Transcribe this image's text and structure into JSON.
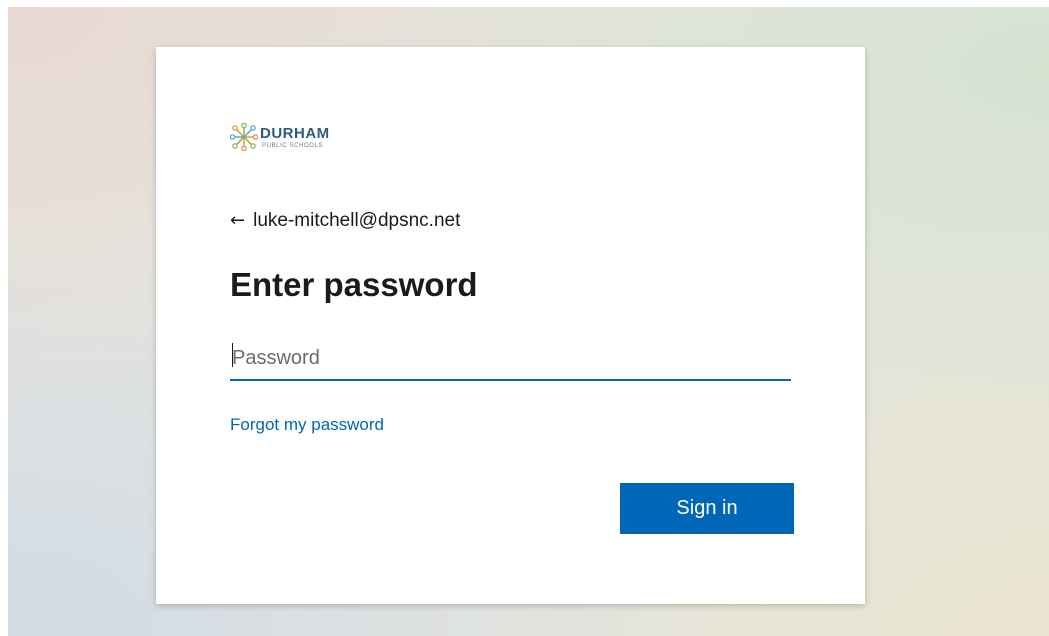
{
  "logo": {
    "name": "DURHAM",
    "sub": "PUBLIC SCHOOLS",
    "colors": [
      "#e98b3a",
      "#4ba7c9",
      "#7cb342",
      "#2e5b86"
    ]
  },
  "identity": {
    "back_icon": "arrow-left-icon",
    "back_glyph": "←",
    "email": "luke-mitchell@dpsnc.net"
  },
  "title": "Enter password",
  "password_field": {
    "placeholder": "Password",
    "value": ""
  },
  "forgot_link": "Forgot my password",
  "signin_button": "Sign in",
  "colors": {
    "accent": "#0067b8",
    "text": "#1b1b1b"
  }
}
